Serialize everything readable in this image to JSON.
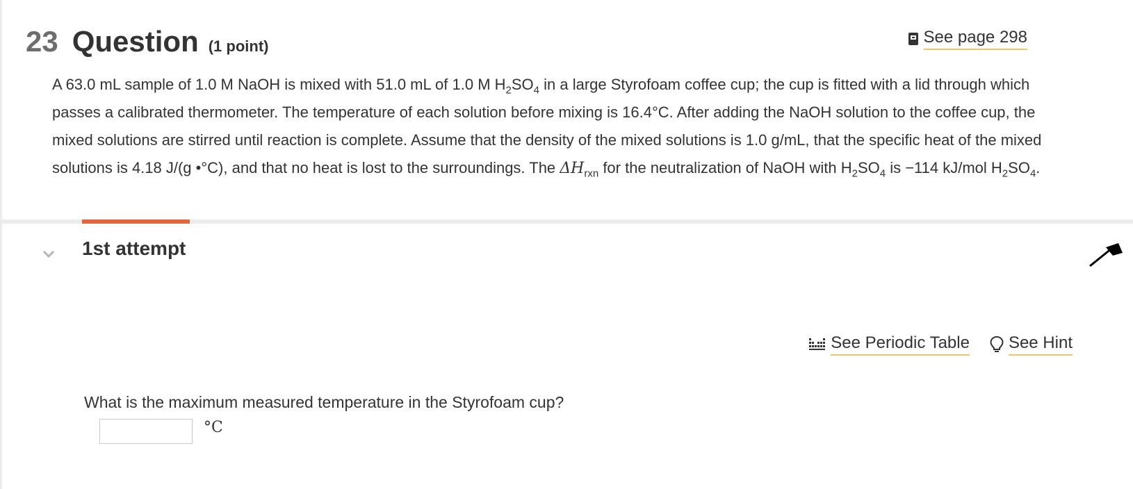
{
  "header": {
    "number": "23",
    "title": "Question",
    "points": "(1 point)",
    "see_page": "See page 298"
  },
  "problem": {
    "s1": "A 63.0 mL sample of 1.0 M NaOH is mixed with 51.0 mL of 1.0 M H",
    "sub2a": "2",
    "s2": "SO",
    "sub4a": "4",
    "s3": " in a large Styrofoam coffee cup; the cup is fitted with a lid through which passes a calibrated thermometer. The temperature of each solution before mixing is 16.4°C. After adding the NaOH solution to the coffee cup, the mixed solutions are stirred until reaction is complete. Assume that the density of the mixed solutions is 1.0 g/mL, that the specific heat of the mixed solutions is 4.18 J/(g •°C), and that no heat is lost to the surroundings. The ",
    "delta_h": "ΔH",
    "rxn": "rxn",
    "s4": " for the neutralization of NaOH with H",
    "sub2b": "2",
    "s5": "SO",
    "sub4b": "4",
    "s6": " is −114 kJ/mol H",
    "sub2c": "2",
    "s7": "SO",
    "sub4c": "4",
    "s8": "."
  },
  "attempt": {
    "title": "1st attempt"
  },
  "tools": {
    "periodic_table": "See Periodic Table",
    "hint": "See Hint"
  },
  "subquestion": {
    "text": "What is the maximum measured temperature in the Styrofoam cup?",
    "input_value": "",
    "unit": "°C"
  },
  "colors": {
    "accent": "#e4643c",
    "link_underline": "#f0c36d"
  }
}
